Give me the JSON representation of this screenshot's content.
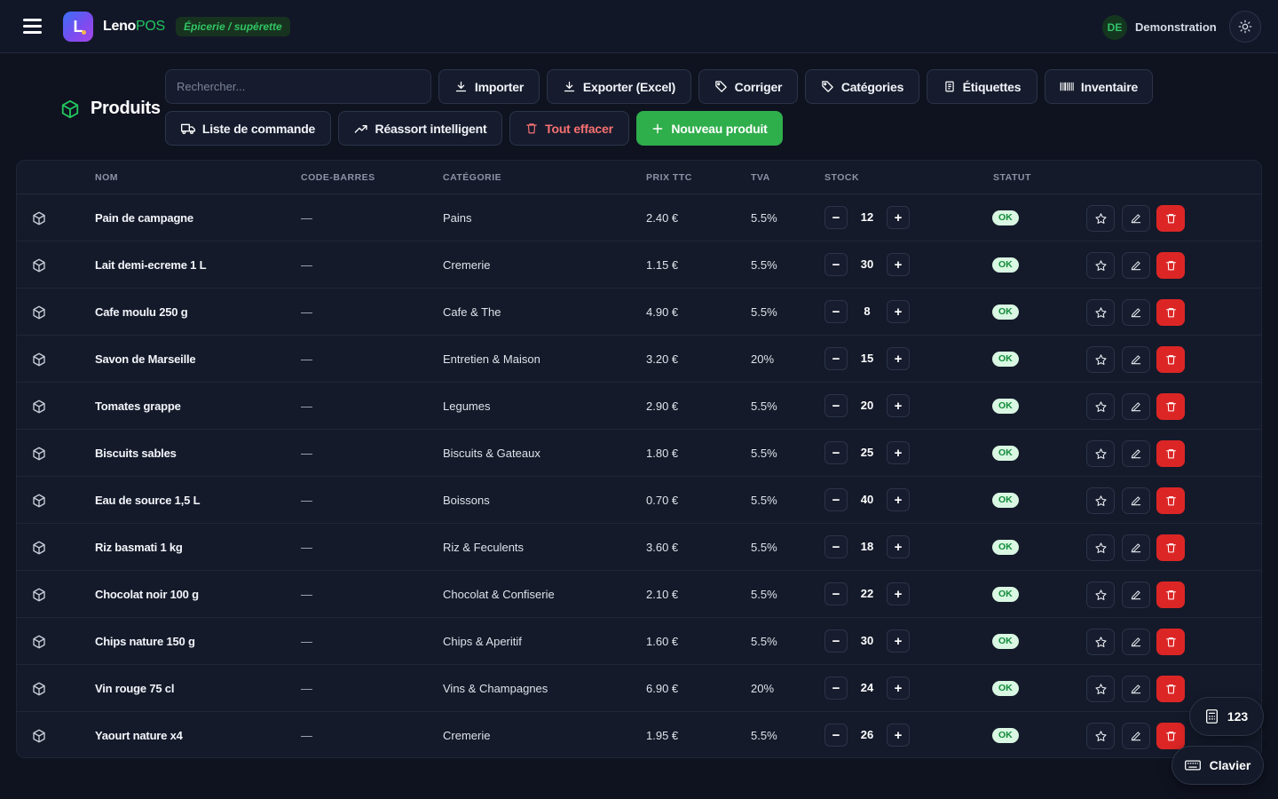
{
  "app": {
    "logo_letter": "L",
    "brand_primary": "Leno",
    "brand_secondary": "POS",
    "shop_type": "Épicerie / supérette",
    "user_initials": "DE",
    "user_name": "Demonstration"
  },
  "page": {
    "title": "Produits"
  },
  "search": {
    "placeholder": "Rechercher..."
  },
  "toolbar": {
    "import": "Importer",
    "export": "Exporter (Excel)",
    "correct": "Corriger",
    "categories": "Catégories",
    "labels": "Étiquettes",
    "inventory": "Inventaire",
    "order_list": "Liste de commande",
    "smart_restock": "Réassort intelligent",
    "clear_all": "Tout effacer",
    "new_product": "Nouveau produit"
  },
  "table": {
    "headers": {
      "name": "NOM",
      "barcode": "CODE-BARRES",
      "category": "CATÉGORIE",
      "price": "PRIX TTC",
      "vat": "TVA",
      "stock": "STOCK",
      "status": "STATUT"
    },
    "rows": [
      {
        "name": "Pain de campagne",
        "barcode": "—",
        "category": "Pains",
        "price": "2.40 €",
        "vat": "5.5%",
        "stock": "12",
        "status": "OK"
      },
      {
        "name": "Lait demi-ecreme 1 L",
        "barcode": "—",
        "category": "Cremerie",
        "price": "1.15 €",
        "vat": "5.5%",
        "stock": "30",
        "status": "OK"
      },
      {
        "name": "Cafe moulu 250 g",
        "barcode": "—",
        "category": "Cafe & The",
        "price": "4.90 €",
        "vat": "5.5%",
        "stock": "8",
        "status": "OK"
      },
      {
        "name": "Savon de Marseille",
        "barcode": "—",
        "category": "Entretien & Maison",
        "price": "3.20 €",
        "vat": "20%",
        "stock": "15",
        "status": "OK"
      },
      {
        "name": "Tomates grappe",
        "barcode": "—",
        "category": "Legumes",
        "price": "2.90 €",
        "vat": "5.5%",
        "stock": "20",
        "status": "OK"
      },
      {
        "name": "Biscuits sables",
        "barcode": "—",
        "category": "Biscuits & Gateaux",
        "price": "1.80 €",
        "vat": "5.5%",
        "stock": "25",
        "status": "OK"
      },
      {
        "name": "Eau de source 1,5 L",
        "barcode": "—",
        "category": "Boissons",
        "price": "0.70 €",
        "vat": "5.5%",
        "stock": "40",
        "status": "OK"
      },
      {
        "name": "Riz basmati 1 kg",
        "barcode": "—",
        "category": "Riz & Feculents",
        "price": "3.60 €",
        "vat": "5.5%",
        "stock": "18",
        "status": "OK"
      },
      {
        "name": "Chocolat noir 100 g",
        "barcode": "—",
        "category": "Chocolat & Confiserie",
        "price": "2.10 €",
        "vat": "5.5%",
        "stock": "22",
        "status": "OK"
      },
      {
        "name": "Chips nature 150 g",
        "barcode": "—",
        "category": "Chips & Aperitif",
        "price": "1.60 €",
        "vat": "5.5%",
        "stock": "30",
        "status": "OK"
      },
      {
        "name": "Vin rouge 75 cl",
        "barcode": "—",
        "category": "Vins & Champagnes",
        "price": "6.90 €",
        "vat": "20%",
        "stock": "24",
        "status": "OK"
      },
      {
        "name": "Yaourt nature x4",
        "barcode": "—",
        "category": "Cremerie",
        "price": "1.95 €",
        "vat": "5.5%",
        "stock": "26",
        "status": "OK"
      }
    ],
    "stepper_minus": "−",
    "stepper_plus": "+"
  },
  "floating": {
    "numpad": "123",
    "keyboard": "Clavier"
  },
  "colors": {
    "accent_green": "#2fae4c",
    "danger_red": "#dc2626",
    "background": "#0f1320",
    "status_ok_bg": "#d9f7e2"
  }
}
